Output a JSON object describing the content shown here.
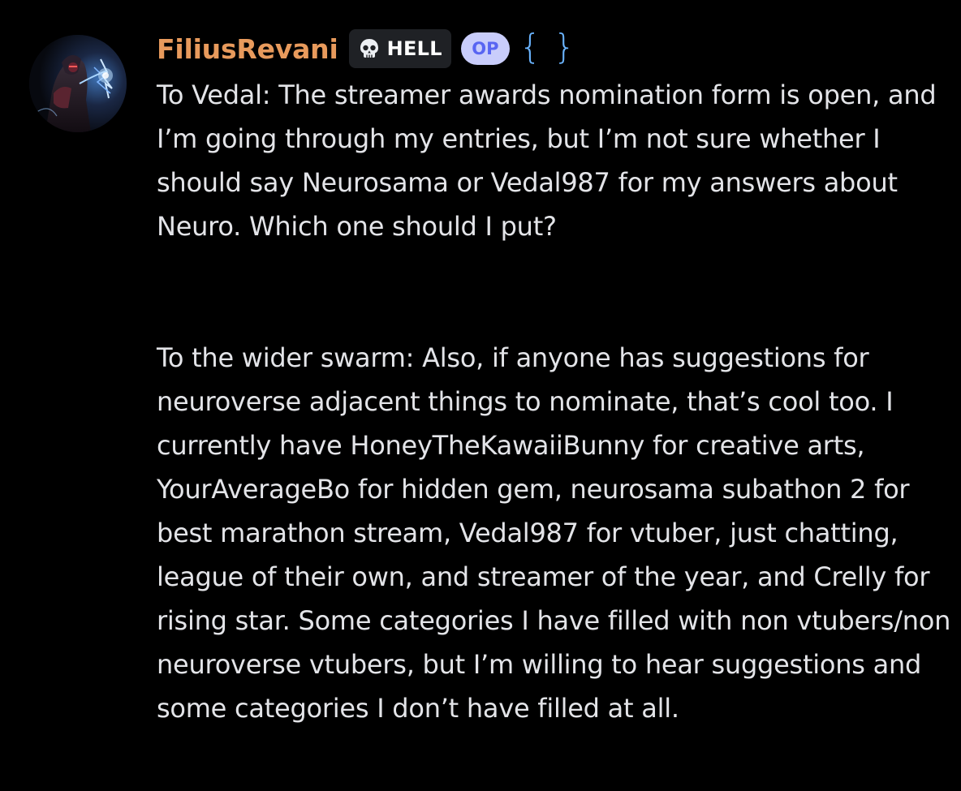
{
  "message": {
    "author": {
      "username": "FiliusRevani",
      "username_color": "#e89a5c",
      "avatar": "avatar"
    },
    "tag": {
      "icon": "skull-icon",
      "label": "HELL"
    },
    "op_badge": {
      "label": "OP",
      "color": "#5865f2"
    },
    "extra_badge": {
      "text": "{ }",
      "color": "#6ab4ff"
    },
    "paragraphs": [
      "To Vedal: The streamer awards nomination form is open, and I’m going through my entries, but I’m not sure whether I should say Neurosama or Vedal987 for my answers about Neuro. Which one should I put?",
      "To the wider swarm: Also, if anyone has suggestions for neuroverse adjacent things to nominate, that’s cool too. I currently have HoneyTheKawaiiBunny for creative arts, YourAverageBo for hidden gem, neurosama subathon 2 for best marathon stream, Vedal987 for vtuber, just chatting, league of their own, and streamer of the year, and Crelly for rising star. Some categories I have filled with non vtubers/non neuroverse vtubers, but I’m willing to hear suggestions and some categories I don’t have filled at all."
    ]
  }
}
